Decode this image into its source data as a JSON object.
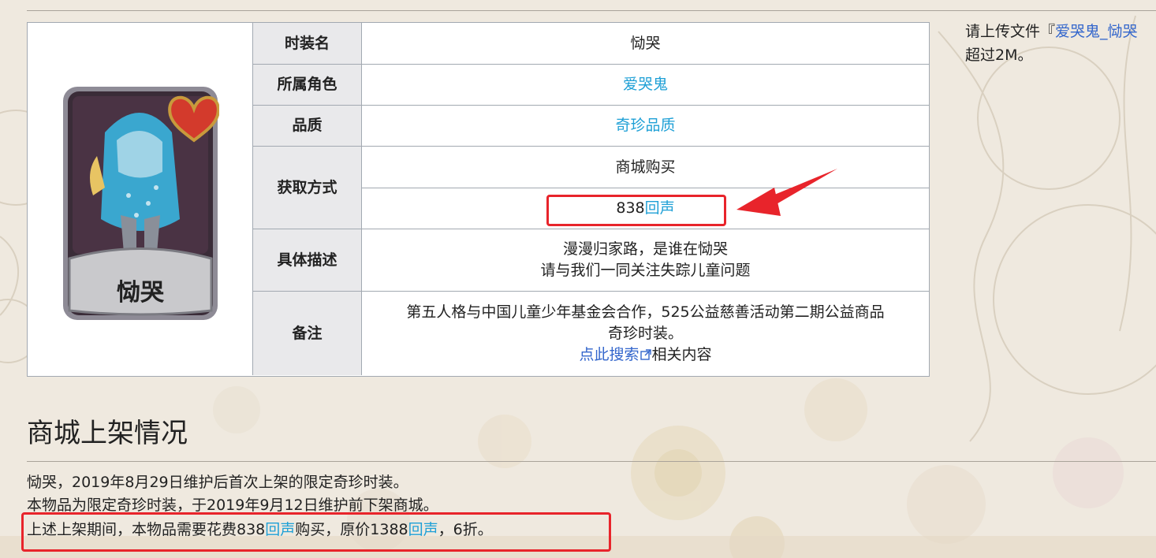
{
  "infobox": {
    "image_caption": "恸哭",
    "rows": [
      {
        "label": "时装名",
        "value": "恸哭"
      },
      {
        "label": "所属角色",
        "value": "爱哭鬼"
      },
      {
        "label": "品质",
        "value": "奇珍品质"
      },
      {
        "label": "获取方式",
        "value": "商城购买",
        "value2_number": "838",
        "value2_currency": "回声"
      },
      {
        "label": "具体描述",
        "value_line1": "漫漫归家路，是谁在恸哭",
        "value_line2": "请与我们一同关注失踪儿童问题"
      },
      {
        "label": "备注",
        "value_line1": "第五人格与中国儿童少年基金会合作，525公益慈善活动第二期公益商品",
        "value_line2": "奇珍时装。",
        "link": "点此搜索",
        "link_suffix": "相关内容"
      }
    ]
  },
  "side_note": {
    "line1_prefix": "请上传文件『",
    "line1_link": "爱哭鬼_恸哭",
    "line2": "超过2M。"
  },
  "section": {
    "heading": "商城上架情况",
    "line1": "恸哭，2019年8月29日维护后首次上架的限定奇珍时装。",
    "line2": "本物品为限定奇珍时装，于2019年9月12日维护前下架商城。",
    "line3_a": "上述上架期间，本物品需要花费838",
    "line3_link1": "回声",
    "line3_b": "购买，原价1388",
    "line3_link2": "回声",
    "line3_c": "，6折。"
  },
  "colors": {
    "accent_link": "#1fa0d6",
    "link_dark": "#3366cc",
    "annotation_red": "#e8242b",
    "label_bg": "#e9e9eb"
  }
}
